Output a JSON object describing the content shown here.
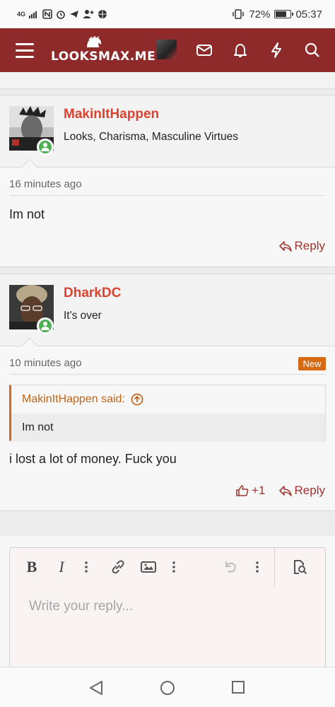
{
  "status_bar": {
    "network": "4G",
    "battery_percent": "72%",
    "battery_level": 0.72,
    "time": "05:37"
  },
  "header": {
    "site_name": "LOOKSMAX.ME",
    "icons": [
      "menu-icon",
      "avatar",
      "mail-icon",
      "bell-icon",
      "bolt-icon",
      "search-icon"
    ]
  },
  "posts": [
    {
      "username": "MakinItHappen",
      "user_title": "Looks, Charisma, Masculine Virtues",
      "time": "16 minutes ago",
      "body": "Im not",
      "reply_label": "Reply"
    },
    {
      "username": "DharkDC",
      "user_title": "It's over",
      "time": "10 minutes ago",
      "badge": "New",
      "quote_author": "MakinItHappen said:",
      "quote_text": "Im not",
      "body": "i lost a lot of money. Fuck you",
      "like_count": "+1",
      "reply_label": "Reply"
    }
  ],
  "editor": {
    "placeholder": "Write your reply...",
    "tools": [
      "bold-icon",
      "italic-icon",
      "more-icon",
      "link-icon",
      "image-icon",
      "more-icon",
      "undo-icon",
      "more-icon",
      "preview-icon"
    ]
  },
  "colors": {
    "brand": "#8e2a2a",
    "username": "#d9432f",
    "accent": "#a2342d",
    "badge": "#d56a13"
  }
}
